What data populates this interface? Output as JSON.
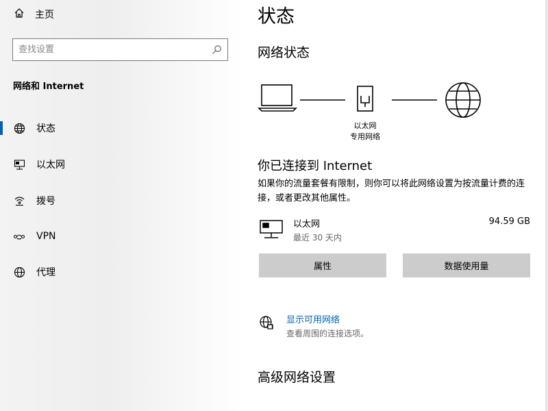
{
  "sidebar": {
    "home_label": "主页",
    "search_placeholder": "查找设置",
    "section_title": "网络和 Internet",
    "items": [
      {
        "label": "状态",
        "icon": "globe-icon",
        "active": true
      },
      {
        "label": "以太网",
        "icon": "ethernet-icon"
      },
      {
        "label": "拨号",
        "icon": "dialup-icon"
      },
      {
        "label": "VPN",
        "icon": "vpn-icon"
      },
      {
        "label": "代理",
        "icon": "proxy-globe-icon"
      }
    ]
  },
  "main": {
    "title": "状态",
    "network_status_heading": "网络状态",
    "diagram": {
      "adapter_label_1": "以太网",
      "adapter_label_2": "专用网络"
    },
    "connected_heading": "你已连接到 Internet",
    "connected_desc": "如果你的流量套餐有限制，则你可以将此网络设置为按流量计费的连接，或者更改其他属性。",
    "ethernet": {
      "name": "以太网",
      "period": "最近 30 天内",
      "usage": "94.59 GB"
    },
    "buttons": {
      "properties": "属性",
      "data_usage": "数据使用量"
    },
    "available_networks": {
      "label": "显示可用网络",
      "desc": "查看周围的连接选项。"
    },
    "advanced_heading": "高级网络设置"
  },
  "colors": {
    "accent": "#0063b1",
    "button_bg": "#cccccc"
  }
}
